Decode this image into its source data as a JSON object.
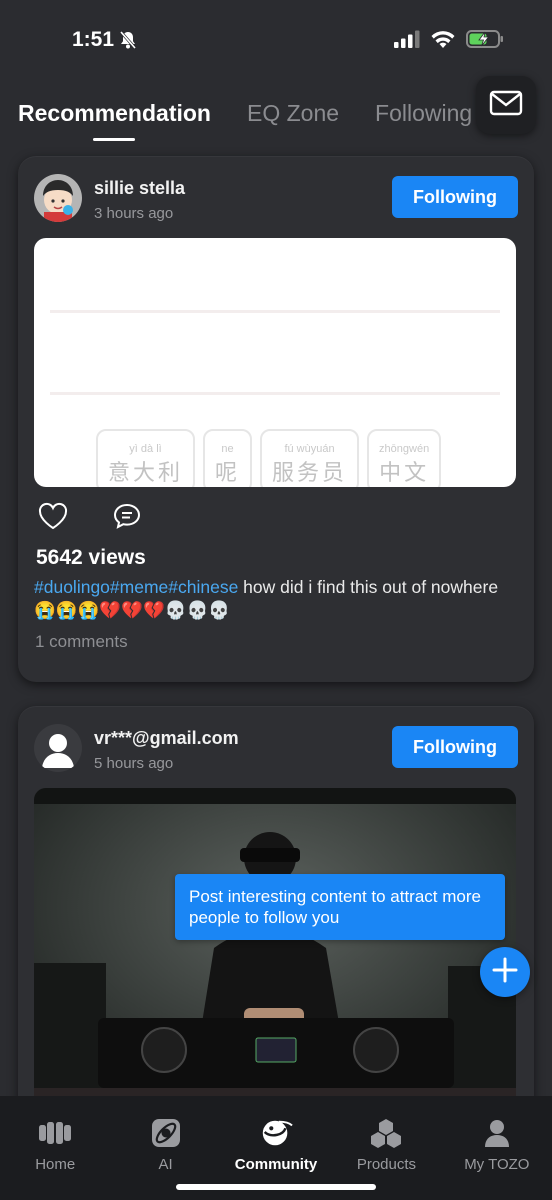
{
  "status": {
    "time": "1:51"
  },
  "tabs": [
    {
      "label": "Recommendation",
      "active": true
    },
    {
      "label": "EQ Zone",
      "active": false
    },
    {
      "label": "Following",
      "active": false
    }
  ],
  "posts": [
    {
      "author": "sillie stella",
      "time": "3 hours ago",
      "follow_label": "Following",
      "views": "5642 views",
      "hashtags": "#duolingo#meme#chinese",
      "caption": " how did i find this out of nowhere 😭😭😭💔💔💔💀💀💀",
      "comments": "1 comments",
      "image_chips": [
        {
          "pinyin": "yì dà lì",
          "hanzi": "意大利"
        },
        {
          "pinyin": "ne",
          "hanzi": "呢"
        },
        {
          "pinyin": "fú wùyuán",
          "hanzi": "服务员"
        },
        {
          "pinyin": "zhōngwén",
          "hanzi": "中文"
        }
      ]
    },
    {
      "author": "vr***@gmail.com",
      "time": "5 hours ago",
      "follow_label": "Following"
    }
  ],
  "tooltip": "Post interesting content to attract more people to follow you",
  "nav": [
    {
      "label": "Home",
      "icon": "home-icon"
    },
    {
      "label": "AI",
      "icon": "ai-icon"
    },
    {
      "label": "Community",
      "icon": "community-icon",
      "active": true
    },
    {
      "label": "Products",
      "icon": "products-icon"
    },
    {
      "label": "My TOZO",
      "icon": "profile-icon"
    }
  ],
  "colors": {
    "accent": "#1a86f5",
    "background": "#2b2c30",
    "card": "#2e2f33",
    "hashtag": "#4aa8f0"
  }
}
